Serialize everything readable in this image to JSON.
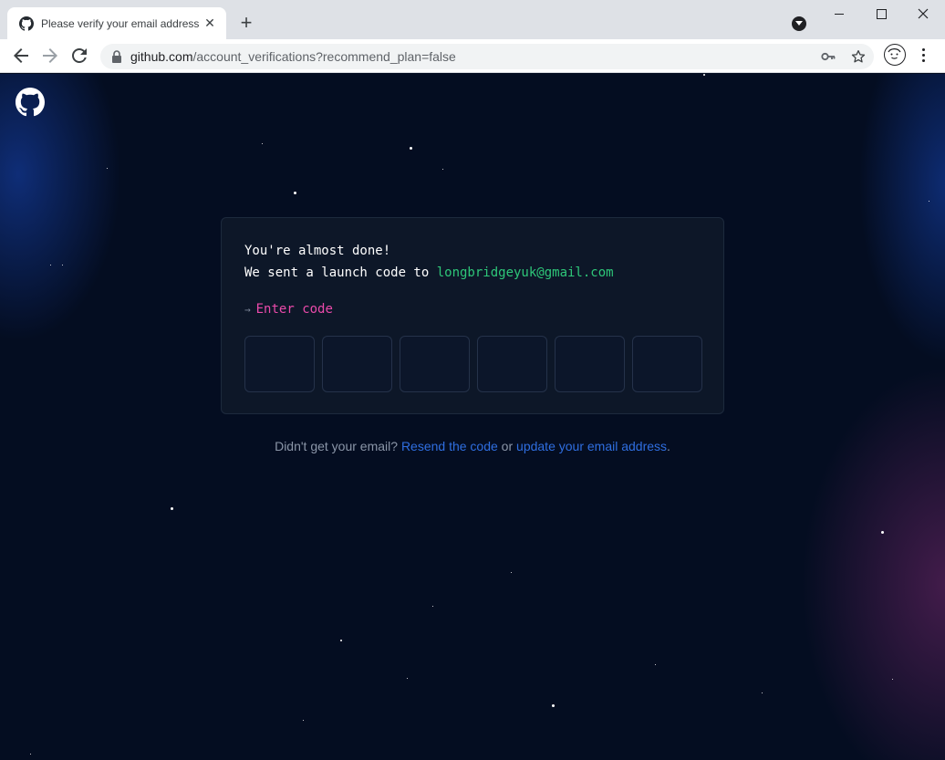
{
  "browser": {
    "tab_title": "Please verify your email address",
    "url_host": "github.com",
    "url_rest": "/account_verifications?recommend_plan=false"
  },
  "card": {
    "heading": "You're almost done!",
    "sent_prefix": "We sent a launch code to ",
    "email": "longbridgeyuk@gmail.com",
    "prompt_arrow": "→",
    "prompt_label": "Enter code",
    "code_fields": [
      "",
      "",
      "",
      "",
      "",
      ""
    ]
  },
  "footer": {
    "question": "Didn't get your email? ",
    "resend_link": "Resend the code",
    "or": " or ",
    "update_link": "update your email address",
    "period": "."
  }
}
